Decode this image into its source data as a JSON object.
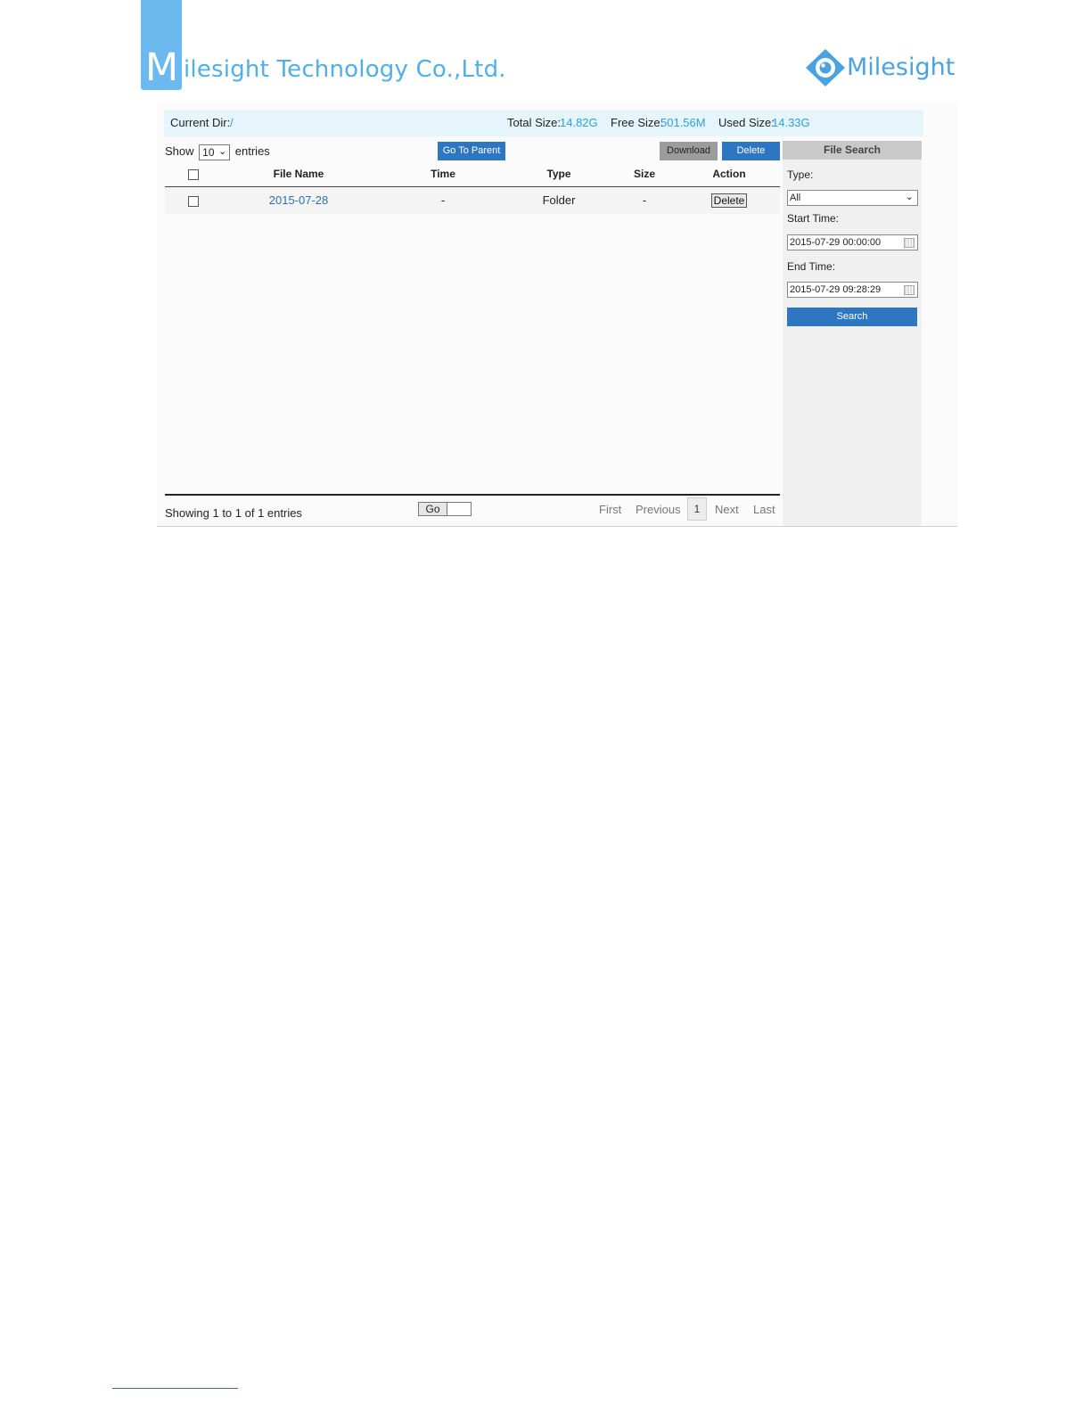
{
  "header": {
    "logo_letter": "M",
    "company": "ilesight Technology Co.,Ltd.",
    "brand": "Milesight"
  },
  "dirbar": {
    "current_dir_label": "Current Dir:",
    "current_dir_value": "/",
    "total_size_label": "Total Size:",
    "total_size_value": "14.82G",
    "free_size_label": "Free Size:",
    "free_size_value": "501.56M",
    "used_size_label": "Used Size:",
    "used_size_value": "14.33G"
  },
  "list": {
    "show_label": "Show",
    "entries_value": "10",
    "entries_label": "entries",
    "go_to_parent": "Go To Parent",
    "download": "Download",
    "delete": "Delete",
    "columns": [
      "File Name",
      "Time",
      "Type",
      "Size",
      "Action"
    ],
    "rows": [
      {
        "name": "2015-07-28",
        "time": "-",
        "type": "Folder",
        "size": "-",
        "action": "Delete"
      }
    ],
    "showing": "Showing 1 to 1 of 1 entries",
    "go": "Go",
    "pager": {
      "first": "First",
      "previous": "Previous",
      "current": "1",
      "next": "Next",
      "last": "Last"
    }
  },
  "search": {
    "title": "File Search",
    "type_label": "Type:",
    "type_value": "All",
    "start_label": "Start Time:",
    "start_value": "2015-07-29 00:00:00",
    "end_label": "End Time:",
    "end_value": "2015-07-29 09:28:29",
    "button": "Search"
  },
  "colors": {
    "accent": "#2e75c2",
    "value_text": "#2e9fd8",
    "header_blue": "#6bb9ef"
  }
}
